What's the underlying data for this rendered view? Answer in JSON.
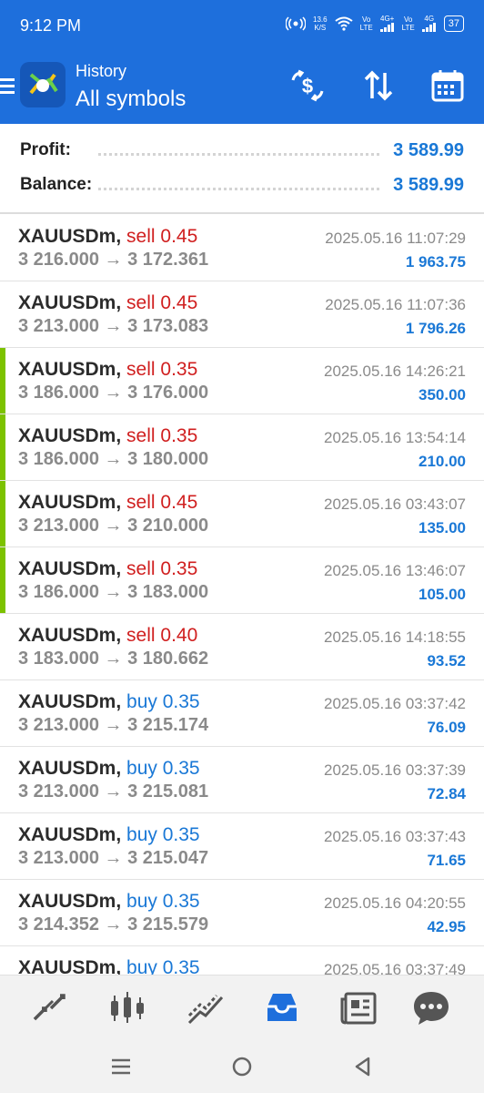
{
  "status_bar": {
    "time": "9:12 PM",
    "net_speed": "13.6",
    "net_unit": "K/S",
    "sim1_top": "Vo",
    "sim1_bottom": "LTE",
    "sim1_gen": "4G+",
    "sim2_top": "Vo",
    "sim2_bottom": "LTE",
    "sim2_gen": "4G",
    "battery": "37"
  },
  "app_bar": {
    "subtitle": "History",
    "title": "All symbols"
  },
  "summary": {
    "profit_label": "Profit:",
    "profit_value": "3 589.99",
    "balance_label": "Balance:",
    "balance_value": "3 589.99"
  },
  "trades": [
    {
      "symbol": "XAUUSDm",
      "side": "sell",
      "volume": "0.45",
      "open": "3 216.000",
      "close": "3 172.361",
      "time": "2025.05.16 11:07:29",
      "profit": "1 963.75",
      "marked": false
    },
    {
      "symbol": "XAUUSDm",
      "side": "sell",
      "volume": "0.45",
      "open": "3 213.000",
      "close": "3 173.083",
      "time": "2025.05.16 11:07:36",
      "profit": "1 796.26",
      "marked": false
    },
    {
      "symbol": "XAUUSDm",
      "side": "sell",
      "volume": "0.35",
      "open": "3 186.000",
      "close": "3 176.000",
      "time": "2025.05.16 14:26:21",
      "profit": "350.00",
      "marked": true
    },
    {
      "symbol": "XAUUSDm",
      "side": "sell",
      "volume": "0.35",
      "open": "3 186.000",
      "close": "3 180.000",
      "time": "2025.05.16 13:54:14",
      "profit": "210.00",
      "marked": true
    },
    {
      "symbol": "XAUUSDm",
      "side": "sell",
      "volume": "0.45",
      "open": "3 213.000",
      "close": "3 210.000",
      "time": "2025.05.16 03:43:07",
      "profit": "135.00",
      "marked": true
    },
    {
      "symbol": "XAUUSDm",
      "side": "sell",
      "volume": "0.35",
      "open": "3 186.000",
      "close": "3 183.000",
      "time": "2025.05.16 13:46:07",
      "profit": "105.00",
      "marked": true
    },
    {
      "symbol": "XAUUSDm",
      "side": "sell",
      "volume": "0.40",
      "open": "3 183.000",
      "close": "3 180.662",
      "time": "2025.05.16 14:18:55",
      "profit": "93.52",
      "marked": false
    },
    {
      "symbol": "XAUUSDm",
      "side": "buy",
      "volume": "0.35",
      "open": "3 213.000",
      "close": "3 215.174",
      "time": "2025.05.16 03:37:42",
      "profit": "76.09",
      "marked": false
    },
    {
      "symbol": "XAUUSDm",
      "side": "buy",
      "volume": "0.35",
      "open": "3 213.000",
      "close": "3 215.081",
      "time": "2025.05.16 03:37:39",
      "profit": "72.84",
      "marked": false
    },
    {
      "symbol": "XAUUSDm",
      "side": "buy",
      "volume": "0.35",
      "open": "3 213.000",
      "close": "3 215.047",
      "time": "2025.05.16 03:37:43",
      "profit": "71.65",
      "marked": false
    },
    {
      "symbol": "XAUUSDm",
      "side": "buy",
      "volume": "0.35",
      "open": "3 214.352",
      "close": "3 215.579",
      "time": "2025.05.16 04:20:55",
      "profit": "42.95",
      "marked": false
    },
    {
      "symbol": "XAUUSDm",
      "side": "buy",
      "volume": "0.35",
      "open": "",
      "close": "",
      "time": "2025.05.16 03:37:49",
      "profit": "",
      "marked": false
    }
  ],
  "arrow_glyph": "→",
  "bottom_nav": {
    "items": [
      "quotes-icon",
      "chart-icon",
      "trade-icon",
      "history-icon",
      "news-icon",
      "chat-icon"
    ],
    "active_index": 3
  },
  "colors": {
    "primary": "#1e6fdc",
    "sell": "#d01f1f",
    "buy": "#1a78d6",
    "profit": "#1a78d6",
    "marker": "#7cc200"
  }
}
